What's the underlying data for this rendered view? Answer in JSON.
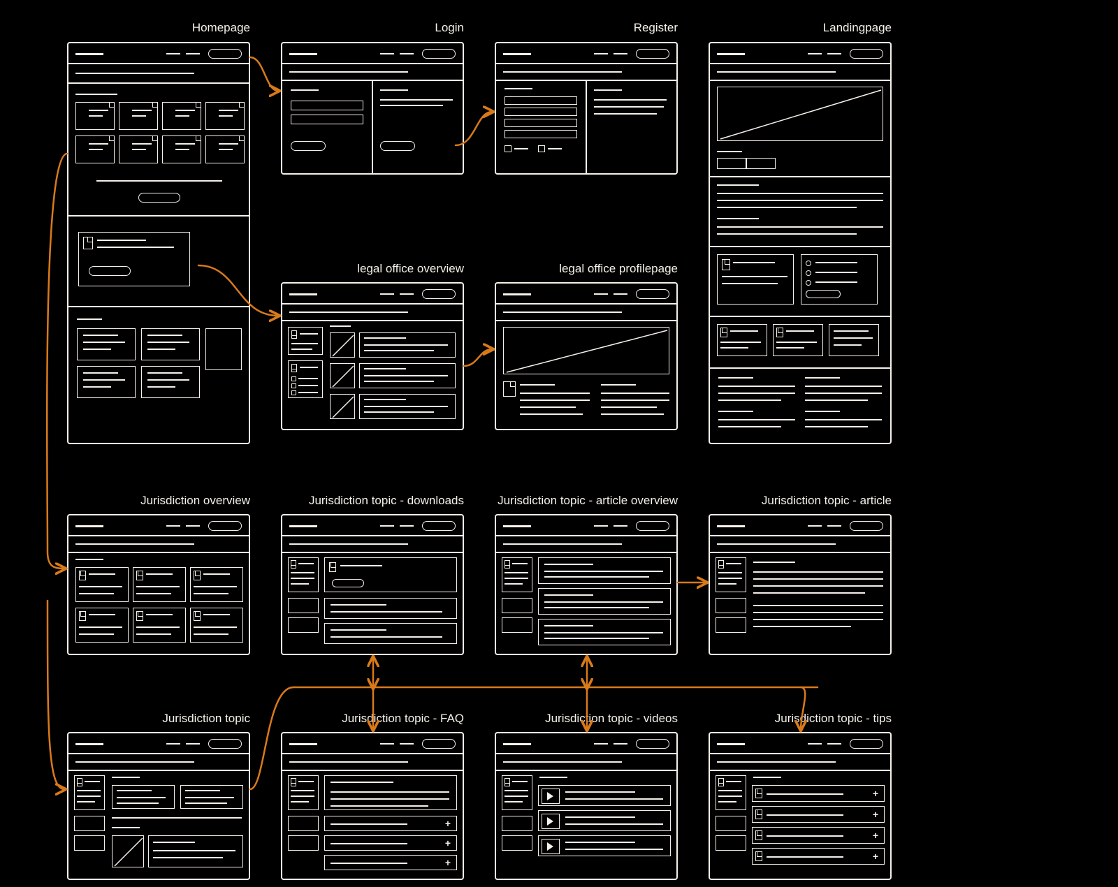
{
  "labels": {
    "homepage": "Homepage",
    "login": "Login",
    "register": "Register",
    "landing": "Landingpage",
    "legal_overview": "legal office overview",
    "legal_profile": "legal office profilepage",
    "jur_overview": "Jurisdiction overview",
    "jur_downloads": "Jurisdiction topic - downloads",
    "jur_article_overview": "Jurisdiction topic - article overview",
    "jur_article": "Jurisdiction topic - article",
    "jur_topic": "Jurisdiction topic",
    "jur_faq": "Jurisdiction topic - FAQ",
    "jur_videos": "Jurisdiction topic - videos",
    "jur_tips": "Jurisdiction topic - tips"
  }
}
